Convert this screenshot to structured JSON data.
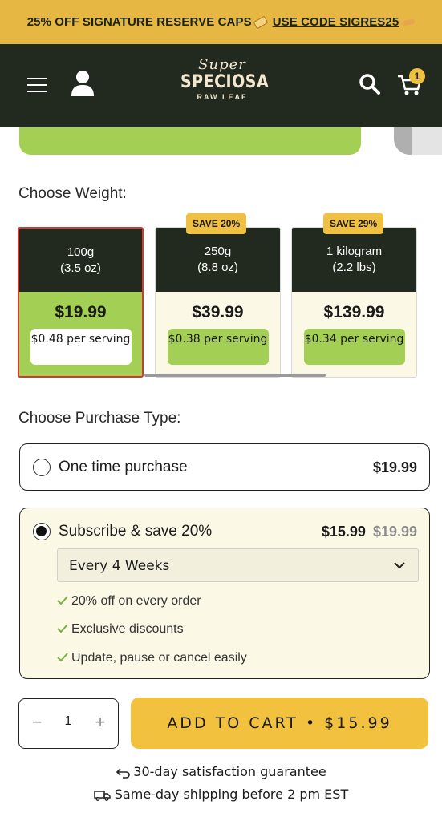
{
  "promo": {
    "text": "25% OFF SIGNATURE RESERVE CAPS",
    "code_text": "USE CODE SIGRES25"
  },
  "header": {
    "logo_super": "Super",
    "logo_main": "SPECIOSA",
    "logo_sub": "RAW LEAF",
    "cart_count": "1"
  },
  "weight": {
    "label": "Choose Weight:",
    "options": [
      {
        "weight": "100g",
        "weight_alt": "(3.5 oz)",
        "price": "$19.99",
        "per_serving": "$0.48 per serving",
        "badge": ""
      },
      {
        "weight": "250g",
        "weight_alt": "(8.8 oz)",
        "price": "$39.99",
        "per_serving": "$0.38 per serving",
        "badge": "SAVE 20%"
      },
      {
        "weight": "1 kilogram",
        "weight_alt": "(2.2 lbs)",
        "price": "$139.99",
        "per_serving": "$0.34 per serving",
        "badge": "SAVE 29%"
      }
    ],
    "selected_index": 0
  },
  "purchase": {
    "label": "Choose Purchase Type:",
    "one_time": {
      "label": "One time purchase",
      "price": "$19.99"
    },
    "subscribe": {
      "label": "Subscribe & save 20%",
      "price": "$15.99",
      "original_price": "$19.99",
      "frequency": "Every 4 Weeks",
      "benefits": [
        "20% off on every order",
        "Exclusive discounts",
        "Update, pause or cancel easily"
      ]
    },
    "selected": "subscribe"
  },
  "cart": {
    "quantity": "1",
    "minus": "−",
    "plus": "+",
    "add_label": "ADD TO CART • $15.99"
  },
  "guarantees": {
    "satisfaction": "30-day satisfaction guarantee",
    "shipping": "Same-day shipping before 2 pm EST"
  },
  "colors": {
    "accent_yellow": "#f2c23e",
    "dark_green": "#222a1f",
    "light_green": "#a4cf55",
    "cream": "#fcf8e6",
    "selected_border": "#d3392f"
  }
}
